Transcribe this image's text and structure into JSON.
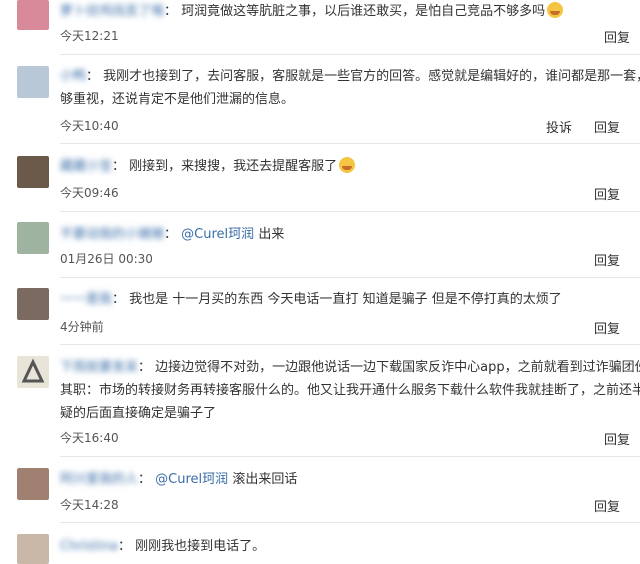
{
  "comments": [
    {
      "name": "萝卜纹鸡找丢了咯",
      "text": "珂润竟做这等肮脏之事，以后谁还敢买，是怕自己竞品不够多吗",
      "time": "今天12:21",
      "reply": "回复",
      "avatar_color": "#d98a9a"
    },
    {
      "name": "小鸭",
      "text1": "我刚才也接到了，去问客服，客服就是一些官方的回答。感觉就是编辑好的，谁问都是那一套，",
      "text2": "够重视，还说肯定不是他们泄漏的信息。",
      "time": "今天10:40",
      "report": "投诉",
      "reply": "回复",
      "avatar_color": "#b9c8d6"
    },
    {
      "name": "藏藏小宝",
      "text": "刚接到，来搜搜，我还去提醒客服了",
      "time": "今天09:46",
      "reply": "回复",
      "avatar_color": "#6b5a4a"
    },
    {
      "name": "不要动我的小猪猪",
      "mention": "@Curel珂润",
      "text": "出来",
      "time": "01月26日 00:30",
      "reply": "回复",
      "avatar_color": "#9fb3a1"
    },
    {
      "name": "一一是我",
      "text": "我也是 十一月买的东西 今天电话一直打 知道是骗子 但是不停打真的太烦了",
      "time": "4分钟前",
      "reply": "回复",
      "avatar_color": "#7a6a60"
    },
    {
      "name": "下雨就要发呆",
      "text1": "边接边觉得不对劲，一边跟他说话一边下载国家反诈中心app，之前就看到过诈骗团伙",
      "text2": "其职：市场的转接财务再转接客服什么的。他又让我开通什么服务下载什么软件我就挂断了，之前还半信",
      "text3": "疑的后面直接确定是骗子了",
      "time": "今天16:40",
      "reply": "回复",
      "avatar_color": "#8a8a6a"
    },
    {
      "name": "阿兴爱我的人",
      "mention": "@Curel珂润",
      "text": "滚出来回话",
      "time": "今天14:28",
      "reply": "回复",
      "avatar_color": "#a08070"
    },
    {
      "name": "Christina",
      "text": "刚刚我也接到电话了。",
      "avatar_color": "#c9b7a8"
    }
  ],
  "colon": "："
}
